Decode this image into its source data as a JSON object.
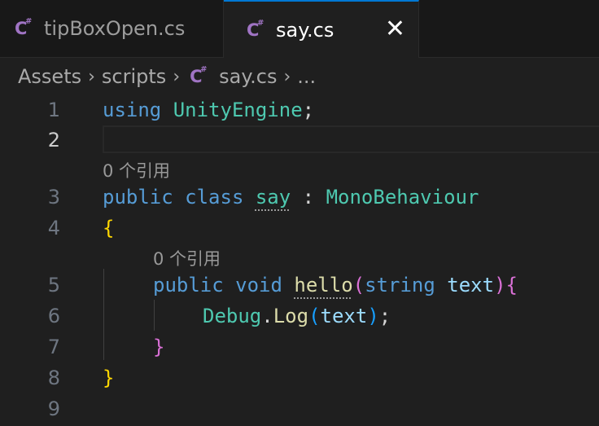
{
  "tabs": [
    {
      "label": "tipBoxOpen.cs",
      "icon": "csharp-file-icon",
      "active": false
    },
    {
      "label": "say.cs",
      "icon": "csharp-file-icon",
      "active": true,
      "close_glyph": "✕"
    }
  ],
  "breadcrumb": {
    "items": [
      "Assets",
      "scripts",
      "say.cs",
      "..."
    ],
    "separator": "›",
    "icon": "csharp-file-icon"
  },
  "icon_text": {
    "letter": "C",
    "hash": "#"
  },
  "editor": {
    "line_numbers": [
      "1",
      "2",
      "3",
      "4",
      "5",
      "6",
      "7",
      "8",
      "9"
    ],
    "current_line": "2",
    "codelens": {
      "class_refs": "0 个引用",
      "method_refs": "0 个引用"
    },
    "lines": {
      "l1": {
        "kw": "using",
        "ns": "UnityEngine",
        "end": ";"
      },
      "l3": {
        "kw1": "public",
        "kw2": "class",
        "name": "say",
        "colon": ":",
        "base": "MonoBehaviour"
      },
      "l4": {
        "brace": "{"
      },
      "l5": {
        "kw1": "public",
        "kw2": "void",
        "name": "hello",
        "open": "(",
        "ptype": "string",
        "pname": "text",
        "close": ")",
        "brace": "{"
      },
      "l6": {
        "cls": "Debug",
        "dot": ".",
        "method": "Log",
        "open": "(",
        "arg": "text",
        "close": ")",
        "end": ";"
      },
      "l7": {
        "brace": "}"
      },
      "l8": {
        "brace": "}"
      }
    }
  },
  "colors": {
    "background": "#1f1f1f",
    "tab_active_border": "#0078d4",
    "keyword": "#569cd6",
    "type": "#4ec9b0",
    "function": "#dcdcaa",
    "variable": "#9cdcfe",
    "bracket_level1": "#ffd700",
    "bracket_level2": "#da70d6",
    "bracket_level3": "#179fff",
    "csharp_icon": "#a074c4"
  }
}
